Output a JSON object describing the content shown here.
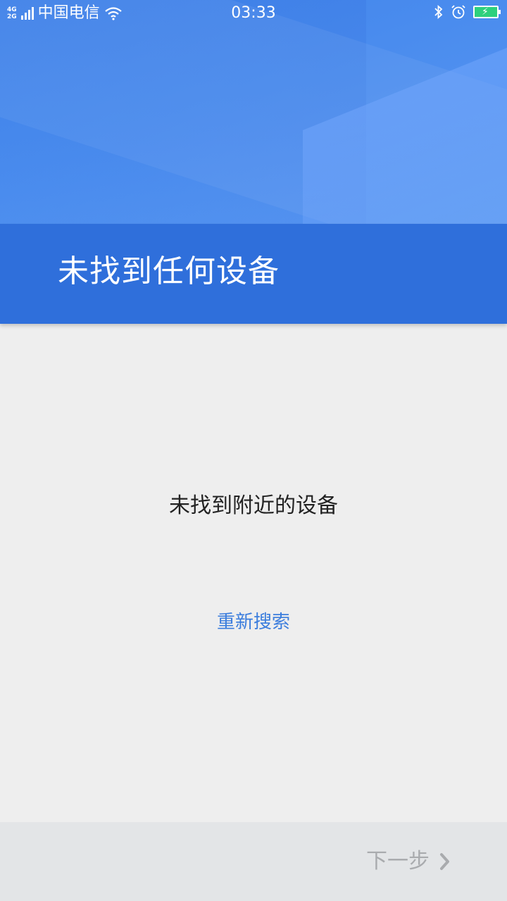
{
  "status_bar": {
    "network_top": "4G",
    "network_bottom": "2G",
    "carrier": "中国电信",
    "time": "03:33",
    "icons": [
      "signal-icon",
      "wifi-icon",
      "bluetooth-icon",
      "alarm-icon",
      "battery-icon"
    ],
    "battery_color": "#2ed07d"
  },
  "header": {
    "title": "未找到任何设备",
    "band_color": "#2f6fdb",
    "hero_color": "#4a8cee"
  },
  "main": {
    "message": "未找到附近的设备",
    "retry_label": "重新搜索",
    "link_color": "#3b7ddd"
  },
  "footer": {
    "next_label": "下一步",
    "next_icon": "chevron-right-icon"
  }
}
